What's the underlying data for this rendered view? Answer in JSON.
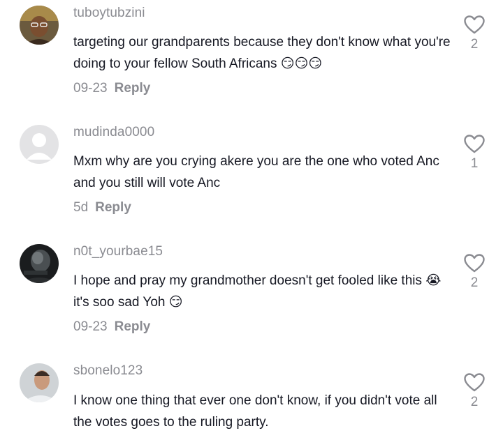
{
  "comments": [
    {
      "username": "tuboytubzini",
      "text": "targeting our grandparents because they don't know what you're doing to your fellow South Africans",
      "emoji": "😏😏😏",
      "date": "09-23",
      "reply_label": "Reply",
      "likes": "2",
      "avatar": "avatar-photo-man-glasses"
    },
    {
      "username": "mudinda0000",
      "text": "Mxm why are you crying akere you are the one who voted Anc and you still will vote Anc",
      "date": "5d",
      "reply_label": "Reply",
      "likes": "1",
      "avatar": "default-avatar-icon"
    },
    {
      "username": "n0t_yourbae15",
      "text_before": "I hope and pray my grandmother doesn't get fooled like this",
      "emoji_mid": "😭",
      "text_after": "it's soo sad Yoh",
      "emoji_end": "😏",
      "date": "09-23",
      "reply_label": "Reply",
      "likes": "2",
      "avatar": "avatar-photo-dark"
    },
    {
      "username": "sbonelo123",
      "text": "I know one thing that ever one don't know, if you didn't vote all the votes goes to the ruling party.",
      "likes": "2",
      "avatar": "avatar-photo-man"
    }
  ],
  "colors": {
    "text": "#161823",
    "secondary": "#8a8b91",
    "background": "#ffffff"
  }
}
